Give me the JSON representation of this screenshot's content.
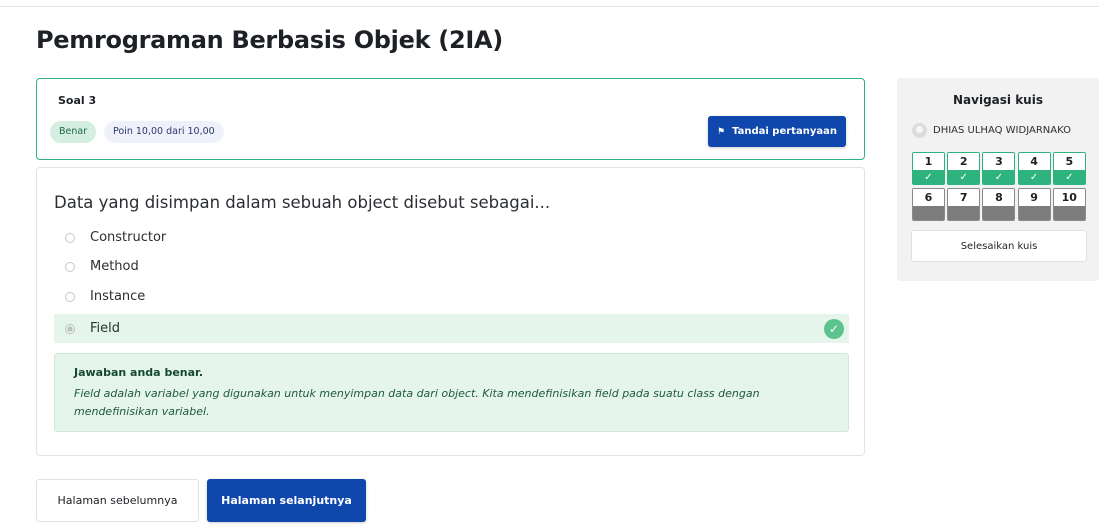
{
  "page": {
    "title": "Pemrograman Berbasis Objek (2IA)"
  },
  "question_info": {
    "number_label": "Soal 3",
    "status_badge": "Benar",
    "points_badge": "Poin 10,00 dari 10,00",
    "flag_button": "Tandai pertanyaan",
    "flag_icon": "flag-icon"
  },
  "question": {
    "text": "Data yang disimpan dalam sebuah object disebut sebagai...",
    "options": [
      {
        "label": "Constructor",
        "selected": false
      },
      {
        "label": "Method",
        "selected": false
      },
      {
        "label": "Instance",
        "selected": false
      },
      {
        "label": "Field",
        "selected": true,
        "correct": true
      }
    ],
    "check_icon": "check-icon"
  },
  "feedback": {
    "title": "Jawaban anda benar.",
    "text": "Field adalah variabel yang digunakan untuk menyimpan data dari object. Kita mendefinisikan field pada suatu class dengan mendefinisikan variabel."
  },
  "navigation_buttons": {
    "prev": "Halaman sebelumnya",
    "next": "Halaman selanjutnya"
  },
  "quiz_nav": {
    "title": "Navigasi kuis",
    "user_name": "DHIAS ULHAQ WIDJARNAKO",
    "questions": [
      {
        "n": "1",
        "answered": true
      },
      {
        "n": "2",
        "answered": true
      },
      {
        "n": "3",
        "answered": true
      },
      {
        "n": "4",
        "answered": true
      },
      {
        "n": "5",
        "answered": true
      },
      {
        "n": "6",
        "answered": false
      },
      {
        "n": "7",
        "answered": false
      },
      {
        "n": "8",
        "answered": false
      },
      {
        "n": "9",
        "answered": false
      },
      {
        "n": "10",
        "answered": false
      }
    ],
    "finish_button": "Selesaikan kuis"
  },
  "colors": {
    "primary": "#0f47ad",
    "success": "#2fb37e",
    "success_bg": "#e6f5ec",
    "unanswered": "#7c7c7c"
  }
}
